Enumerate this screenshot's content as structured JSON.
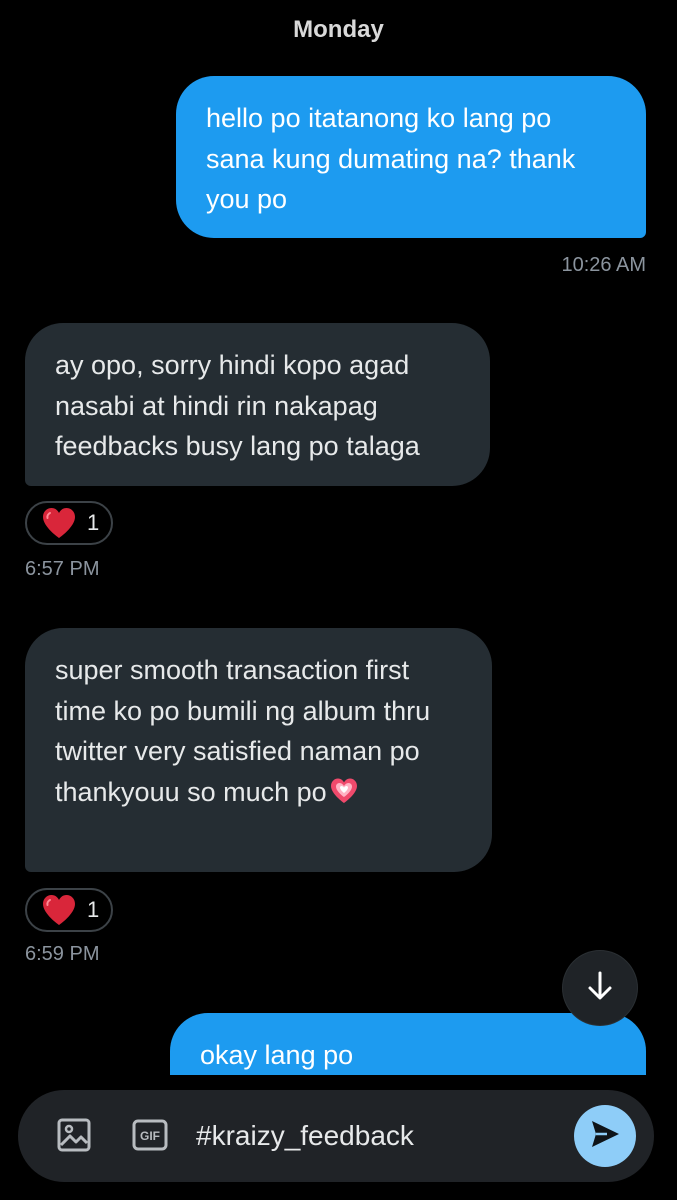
{
  "day_separator": "Monday",
  "messages": [
    {
      "direction": "sent",
      "text": "hello po itatanong ko lang po sana kung dumating na? thank you po",
      "time": "10:26 AM"
    },
    {
      "direction": "received",
      "text": "ay opo, sorry hindi kopo agad nasabi at hindi rin nakapag feedbacks busy lang po talaga",
      "reaction": {
        "emoji": "heart-icon",
        "count": "1"
      },
      "time": "6:57 PM"
    },
    {
      "direction": "received",
      "text": "super smooth transaction first time ko po bumili ng album thru twitter very satisfied naman po thankyouu so much po",
      "trailing_emoji": "sparkling-heart-icon",
      "reaction": {
        "emoji": "heart-icon",
        "count": "1"
      },
      "time": "6:59 PM"
    },
    {
      "direction": "sent",
      "text": "okay lang po"
    }
  ],
  "scroll_button_icon": "arrow-down-icon",
  "composer": {
    "media_icon": "image-icon",
    "gif_label": "GIF",
    "input_value": "#kraizy_feedback",
    "send_icon": "send-icon"
  },
  "colors": {
    "sent_bubble": "#1d9bf0",
    "received_bubble": "#252d33",
    "background": "#000000",
    "send_button": "#8ecdf8",
    "reaction_heart": "#e0245e"
  }
}
